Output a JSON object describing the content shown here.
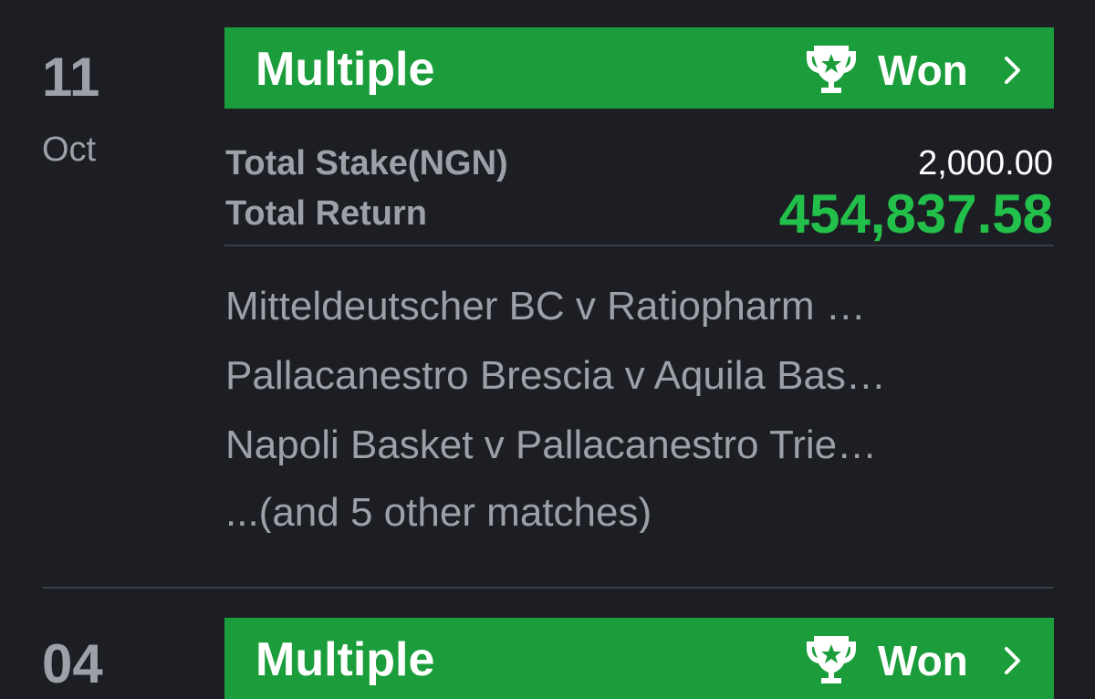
{
  "bets": [
    {
      "day": "11",
      "month": "Oct",
      "type": "Multiple",
      "status": "Won",
      "stake_label": "Total Stake(NGN)",
      "stake_value": "2,000.00",
      "return_label": "Total Return",
      "return_value": "454,837.58",
      "matches": [
        "Mitteldeutscher BC v Ratiopharm …",
        "Pallacanestro Brescia v Aquila Bas…",
        "Napoli Basket v Pallacanestro Trie…",
        "...(and 5 other matches)"
      ]
    },
    {
      "day": "04",
      "type": "Multiple",
      "status": "Won"
    }
  ],
  "icons": {
    "trophy": "trophy-icon",
    "chevron": "chevron-right-icon"
  },
  "colors": {
    "background": "#1c1e24",
    "won_bar": "#1a9d3a",
    "return_green": "#22c04a",
    "muted_text": "#9ea0a8"
  }
}
